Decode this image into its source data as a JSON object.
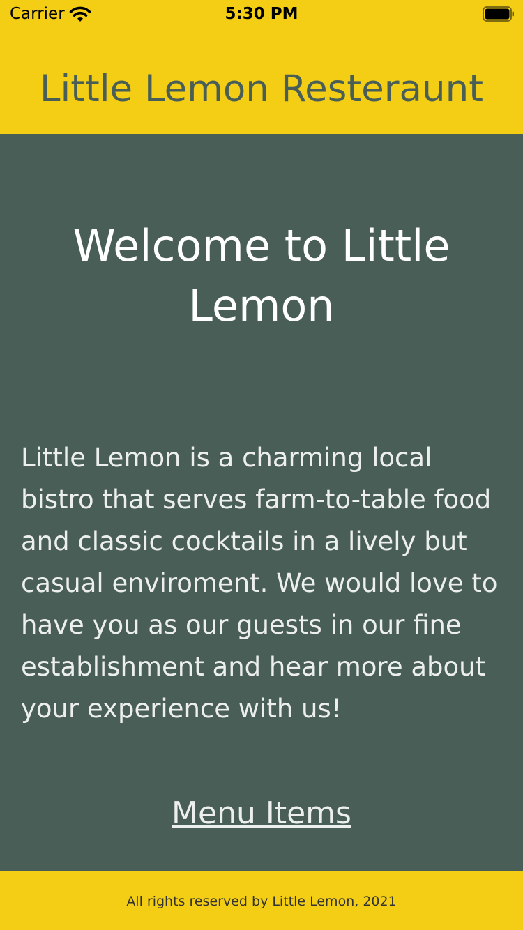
{
  "status_bar": {
    "carrier": "Carrier",
    "time": "5:30 PM",
    "wifi_icon": "wifi-icon",
    "battery_icon": "battery-full-icon"
  },
  "header": {
    "title": "Little Lemon Resteraunt"
  },
  "main": {
    "welcome": "Welcome to Little Lemon",
    "description": "Little Lemon is a charming local bistro that serves farm-to-table food and classic cocktails in a lively but casual enviroment. We would love to have you as our guests in our fine establishment and hear more about your experience with us!",
    "menu_link": "Menu Items"
  },
  "footer": {
    "text": "All rights reserved by Little Lemon, 2021"
  },
  "colors": {
    "primary_yellow": "#F4CE14",
    "primary_green": "#495E57",
    "text_light": "#EDEFEE"
  }
}
